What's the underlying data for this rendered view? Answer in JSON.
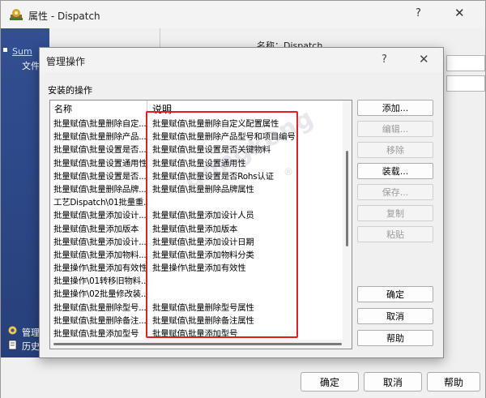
{
  "parent_window": {
    "title": "属性 - Dispatch",
    "help_glyph": "?",
    "close_glyph": "✕",
    "sidebar_link": "Sum",
    "sidebar_file": "文件",
    "sidebar_manage": "管理",
    "sidebar_history": "历史",
    "name_label": "名称：Dispatch",
    "buttons": {
      "ok": "确定",
      "cancel": "取消",
      "help": "帮助"
    }
  },
  "dialog": {
    "title": "管理操作",
    "help_glyph": "?",
    "close_glyph": "✕",
    "installed_label": "安装的操作",
    "columns": {
      "name": "名称",
      "desc": "说明"
    },
    "rows": [
      {
        "name": "批量赋值\\批量删除自定...",
        "desc": "批量赋值\\批量删除自定义配置属性"
      },
      {
        "name": "批量赋值\\批量删除产品...",
        "desc": "批量赋值\\批量删除产品型号和项目编号"
      },
      {
        "name": "批量赋值\\批量设置是否...",
        "desc": "批量赋值\\批量设置是否关键物料"
      },
      {
        "name": "批量赋值\\批量设置通用性",
        "desc": "批量赋值\\批量设置通用性"
      },
      {
        "name": "批量赋值\\批量设置是否...",
        "desc": "批量赋值\\批量设置是否Rohs认证"
      },
      {
        "name": "批量赋值\\批量删除品牌...",
        "desc": "批量赋值\\批量删除品牌属性"
      },
      {
        "name": "工艺Dispatch\\01批量重...",
        "desc": ""
      },
      {
        "name": "批量赋值\\批量添加设计...",
        "desc": "批量赋值\\批量添加设计人员"
      },
      {
        "name": "批量赋值\\批量添加版本",
        "desc": "批量赋值\\批量添加版本"
      },
      {
        "name": "批量赋值\\批量添加设计...",
        "desc": "批量赋值\\批量添加设计日期"
      },
      {
        "name": "批量赋值\\批量添加物料...",
        "desc": "批量赋值\\批量添加物料分类"
      },
      {
        "name": "批量操作\\批量添加有效性",
        "desc": "批量操作\\批量添加有效性"
      },
      {
        "name": "批量操作\\01转移旧物料...",
        "desc": ""
      },
      {
        "name": " 批量操作\\02批量修改装...",
        "desc": ""
      },
      {
        "name": "批量赋值\\批量删除型号...",
        "desc": "批量赋值\\批量删除型号属性"
      },
      {
        "name": "批量赋值\\批量删除备注...",
        "desc": "批量赋值\\批量删除备注属性"
      },
      {
        "name": "批量赋值\\批量添加型号",
        "desc": "批量赋值\\批量添加型号"
      }
    ],
    "buttons": {
      "add": "添加...",
      "edit": "编辑...",
      "remove": "移除",
      "load": "装载...",
      "save": "保存...",
      "copy": "复制",
      "paste": "粘贴",
      "ok": "确定",
      "cancel": "取消",
      "help": "帮助"
    }
  },
  "watermark": {
    "text": "gongkong",
    "reg": "®"
  },
  "colors": {
    "sidebar": "#324f92",
    "highlight": "#e02020"
  }
}
